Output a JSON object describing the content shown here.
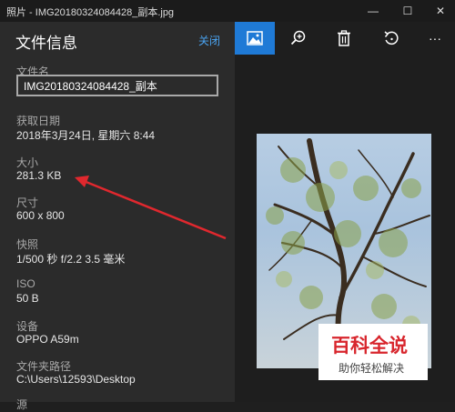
{
  "window": {
    "title": "照片 - IMG20180324084428_副本.jpg",
    "minimize": "—",
    "maximize": "☐",
    "close": "✕"
  },
  "panel": {
    "title": "文件信息",
    "close_label": "关闭",
    "fields": {
      "filename_label": "文件名",
      "filename_value": "IMG20180324084428_副本",
      "date_label": "获取日期",
      "date_value": "2018年3月24日, 星期六 8:44",
      "size_label": "大小",
      "size_value": "281.3 KB",
      "dims_label": "尺寸",
      "dims_value": "600 x 800",
      "shot_label": "快照",
      "shot_value": "1/500 秒 f/2.2 3.5 毫米",
      "iso_label": "ISO",
      "iso_value": "50 B",
      "device_label": "设备",
      "device_value": "OPPO A59m",
      "path_label": "文件夹路径",
      "path_value": "C:\\Users\\12593\\Desktop",
      "cut_label": "源"
    }
  },
  "toolbar": {
    "icons": [
      "image-icon",
      "zoom-icon",
      "delete-icon",
      "rotate-icon",
      "more-icon"
    ],
    "more_label": "···"
  },
  "watermark": {
    "brand": "百科全说",
    "tagline": "助你轻松解决"
  },
  "colors": {
    "accent": "#1f7ad6",
    "link": "#4aa3f0",
    "arrow": "#e0282e"
  }
}
